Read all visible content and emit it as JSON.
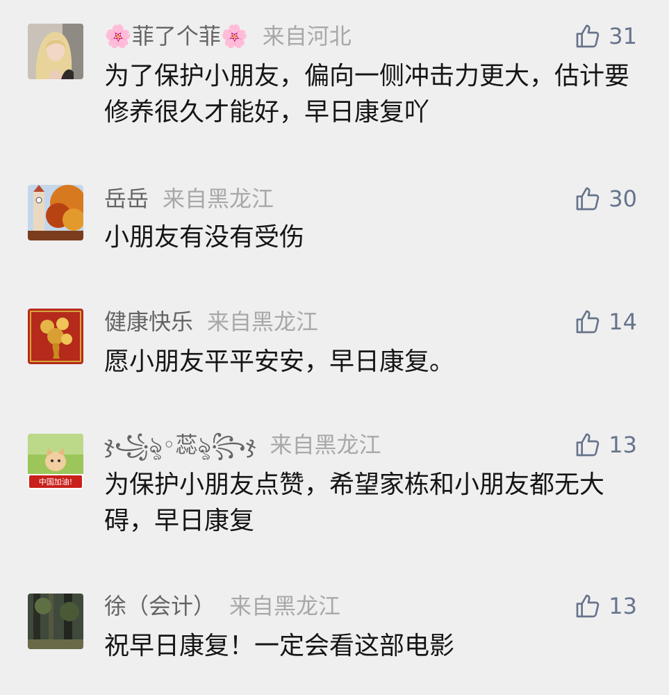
{
  "comments": [
    {
      "name": "菲了个菲",
      "name_prefix": "🌸",
      "name_suffix": "🌸",
      "location": "来自河北",
      "likes": "31",
      "text": "为了保护小朋友，偏向一侧冲击力更大，估计要修养很久才能好，早日康复吖"
    },
    {
      "name": "岳岳",
      "location": "来自黑龙江",
      "likes": "30",
      "text": "小朋友有没有受伤"
    },
    {
      "name": "健康快乐",
      "location": "来自黑龙江",
      "likes": "14",
      "text": "愿小朋友平平安安，早日康复。"
    },
    {
      "name": "ჯ꧁ৡ◦蕊ৡ꧂ჯ",
      "location": "来自黑龙江",
      "likes": "13",
      "text": "为保护小朋友点赞，希望家栋和小朋友都无大碍，早日康复",
      "avatar_label": "中国加油!"
    },
    {
      "name": "徐（会计）",
      "location": "来自黑龙江",
      "likes": "13",
      "text": "祝早日康复！一定会看这部电影"
    }
  ],
  "colors": {
    "background": "#efeff0",
    "name": "#646464",
    "location": "#a8a8a8",
    "like": "#66738a",
    "text": "#151515"
  },
  "icons": {
    "like": "thumbs-up-icon"
  }
}
